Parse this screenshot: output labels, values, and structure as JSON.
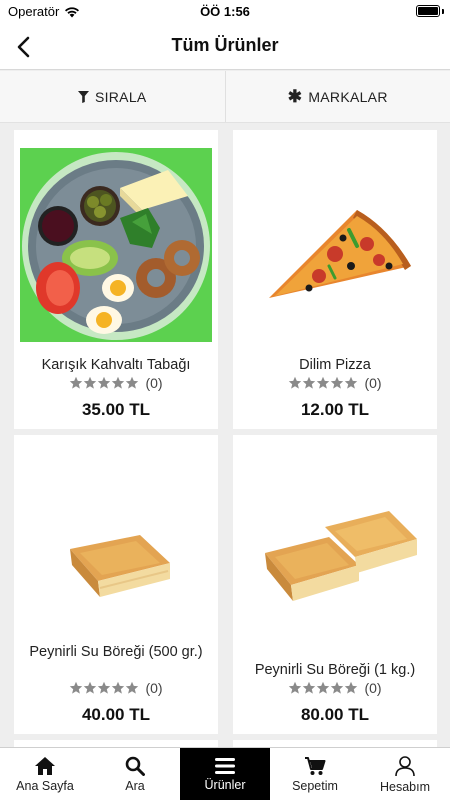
{
  "status": {
    "carrier": "Operatör",
    "time": "ÖÖ 1:56"
  },
  "nav": {
    "title": "Tüm Ürünler"
  },
  "filters": {
    "sort_label": "SIRALA",
    "brands_label": "MARKALAR"
  },
  "products": [
    {
      "name": "Karışık Kahvaltı Tabağı",
      "rating_count": "(0)",
      "rating": 0,
      "price": "35.00 TL"
    },
    {
      "name": "Dilim Pizza",
      "rating_count": "(0)",
      "rating": 0,
      "price": "12.00 TL"
    },
    {
      "name": "Peynirli Su Böreği (500 gr.)",
      "rating_count": "(0)",
      "rating": 0,
      "price": "40.00 TL"
    },
    {
      "name": "Peynirli Su Böreği (1 kg.)",
      "rating_count": "(0)",
      "rating": 0,
      "price": "80.00 TL"
    }
  ],
  "tabs": [
    {
      "label": "Ana Sayfa",
      "icon": "home-icon"
    },
    {
      "label": "Ara",
      "icon": "search-icon"
    },
    {
      "label": "Ürünler",
      "icon": "menu-icon"
    },
    {
      "label": "Sepetim",
      "icon": "cart-icon"
    },
    {
      "label": "Hesabım",
      "icon": "user-icon"
    }
  ],
  "colors": {
    "active_tab": "#000000",
    "star": "#8a8a8a",
    "background": "#eeeeee"
  }
}
